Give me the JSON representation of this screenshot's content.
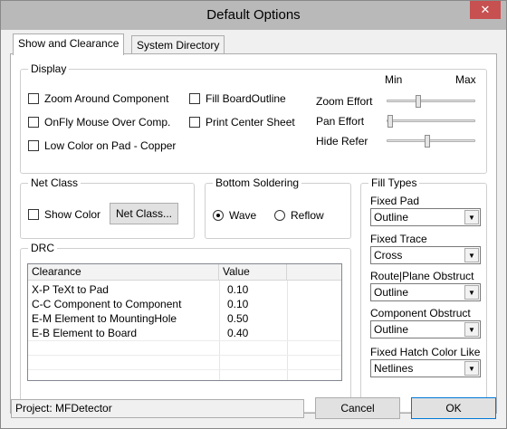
{
  "window": {
    "title": "Default Options",
    "close_glyph": "✕"
  },
  "tabs": [
    {
      "label": "Show and Clearance",
      "active": true
    },
    {
      "label": "System Directory",
      "active": false
    }
  ],
  "display": {
    "legend": "Display",
    "checkboxes": [
      {
        "label": "Zoom Around Component",
        "checked": false
      },
      {
        "label": "OnFly Mouse Over Comp.",
        "checked": false
      },
      {
        "label": "Low Color on Pad - Copper",
        "checked": false
      },
      {
        "label": "Fill BoardOutline",
        "checked": false
      },
      {
        "label": "Print Center Sheet",
        "checked": false
      }
    ],
    "sliders": {
      "min_label": "Min",
      "max_label": "Max",
      "items": [
        {
          "label": "Zoom Effort",
          "level": 0.35
        },
        {
          "label": "Pan Effort",
          "level": 0.0
        },
        {
          "label": "Hide Refer",
          "level": 0.45
        }
      ]
    }
  },
  "net_class": {
    "legend": "Net Class",
    "show_color_label": "Show Color",
    "show_color_checked": false,
    "button_label": "Net Class..."
  },
  "bottom_soldering": {
    "legend": "Bottom Soldering",
    "options": [
      {
        "label": "Wave",
        "selected": true
      },
      {
        "label": "Reflow",
        "selected": false
      }
    ]
  },
  "drc": {
    "legend": "DRC",
    "columns": [
      "Clearance",
      "Value"
    ],
    "rows": [
      {
        "clearance": "X-P  TeXt to Pad",
        "value": "0.10"
      },
      {
        "clearance": "C-C  Component to Component",
        "value": "0.10"
      },
      {
        "clearance": "E-M  Element to MountingHole",
        "value": "0.50"
      },
      {
        "clearance": "E-B  Element to Board",
        "value": "0.40"
      }
    ]
  },
  "fill_types": {
    "legend": "Fill Types",
    "fields": [
      {
        "label": "Fixed Pad",
        "value": "Outline"
      },
      {
        "label": "Fixed Trace",
        "value": "Cross"
      },
      {
        "label": "Route|Plane Obstruct",
        "value": "Outline"
      },
      {
        "label": "Component Obstruct",
        "value": "Outline"
      },
      {
        "label": "Fixed Hatch Color Like",
        "value": "Netlines"
      }
    ]
  },
  "footer": {
    "project_label": "Project: MFDetector",
    "cancel_label": "Cancel",
    "ok_label": "OK"
  }
}
